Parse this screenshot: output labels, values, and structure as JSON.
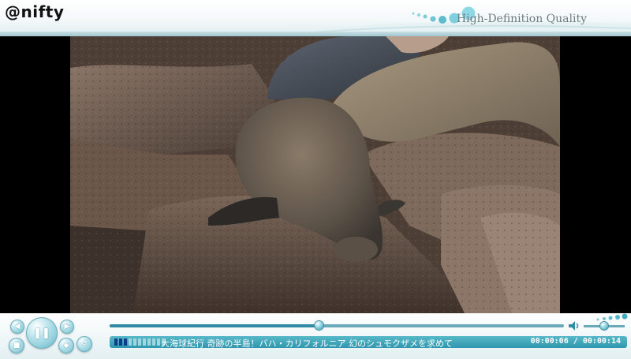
{
  "header": {
    "logo": "@nifty",
    "quality_label": "High-Definition Quality"
  },
  "video": {
    "scene": "sea lions resting on rocks"
  },
  "player": {
    "title": "大海球紀行 奇跡の半島！バハ・カリフォルニア 幻のシュモクザメを求めて",
    "current_time": "00:00:06",
    "time_separator": "/",
    "total_time": "00:00:14",
    "progress": 0.46,
    "volume": 0.5,
    "buffer_segments_total": 11,
    "buffer_segments_loaded": 3,
    "buttons": {
      "play_pause_icon": "pause-icon",
      "rewind_icon": "rewind-icon",
      "forward_icon": "forward-icon",
      "stop_icon": "stop-icon",
      "fullscreen_icon": "fullscreen-icon"
    }
  },
  "colors": {
    "accent": "#2f97ad",
    "accent_light": "#58b8c9",
    "buffer_loaded": "#0e3d8f"
  }
}
